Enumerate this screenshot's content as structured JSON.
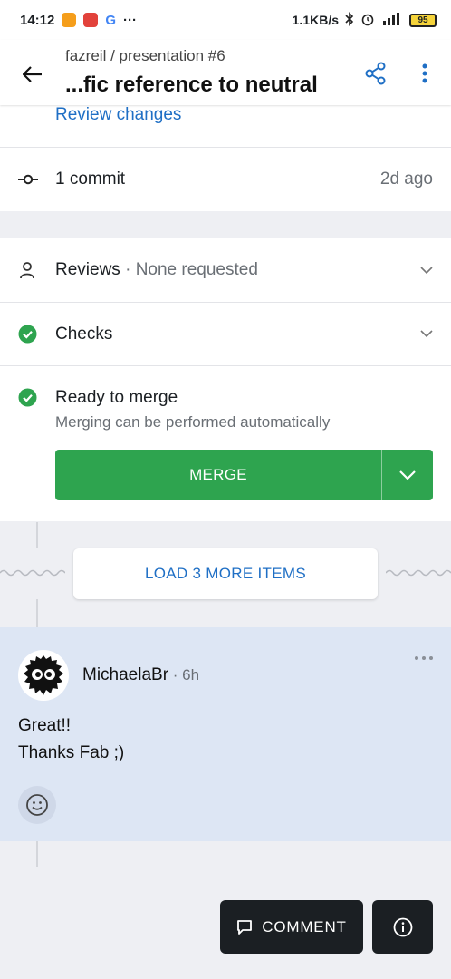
{
  "status_bar": {
    "time": "14:12",
    "more_icon": "···",
    "speed": "1.1KB/s",
    "battery": "95"
  },
  "header": {
    "subtitle": "fazreil / presentation #6",
    "title": "...fic reference to neutral"
  },
  "changes": {
    "review_link": "Review changes",
    "commits_label": "1 commit",
    "commits_time": "2d ago"
  },
  "reviews": {
    "label": "Reviews",
    "separator": " · ",
    "status": "None requested"
  },
  "checks": {
    "label": "Checks"
  },
  "merge": {
    "title": "Ready to merge",
    "subtitle": "Merging can be performed automatically",
    "button_label": "MERGE"
  },
  "timeline": {
    "load_more_label": "LOAD 3 MORE ITEMS"
  },
  "comment": {
    "author": "MichaelaBr",
    "time": " · 6h",
    "lines": [
      "Great!!",
      "Thanks Fab ;)"
    ]
  },
  "actions": {
    "comment_label": "COMMENT"
  },
  "colors": {
    "accent": "#1f6fc5",
    "success": "#2ea44f",
    "comment_bg": "#dde6f4",
    "dark_button": "#1b1f23"
  }
}
